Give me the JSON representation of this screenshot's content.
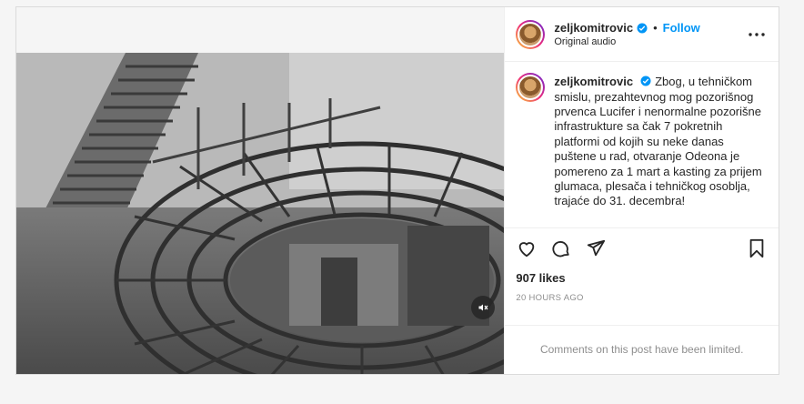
{
  "post": {
    "author": {
      "username": "zeljkomitrovic",
      "verified": true,
      "audio_label": "Original audio",
      "follow_label": "Follow",
      "separator": "•"
    },
    "caption": {
      "username": "zeljkomitrovic",
      "text": "Zbog, u tehničkom smislu, prezahtevnog mog pozorišnog prvenca Lucifer i nenormalne pozorišne infrastrukture sa čak 7 pokretnih platformi od kojih su neke danas puštene u rad, otvaranje Odeona je pomereno za 1 mart a kasting za prijem glumaca, plesača i tehničkog osoblja, trajaće do 31. decembra!"
    },
    "likes": "907 likes",
    "timestamp": "20 HOURS AGO",
    "comments_notice": "Comments on this post have been limited.",
    "media": {
      "type": "video",
      "muted": true,
      "icons": [
        "mute-icon"
      ]
    },
    "action_icons": [
      "heart-icon",
      "comment-icon",
      "share-icon",
      "bookmark-icon"
    ],
    "colors": {
      "accent": "#0095f6",
      "verified": "#0095f6",
      "muted_text": "#8e8e8e"
    }
  }
}
